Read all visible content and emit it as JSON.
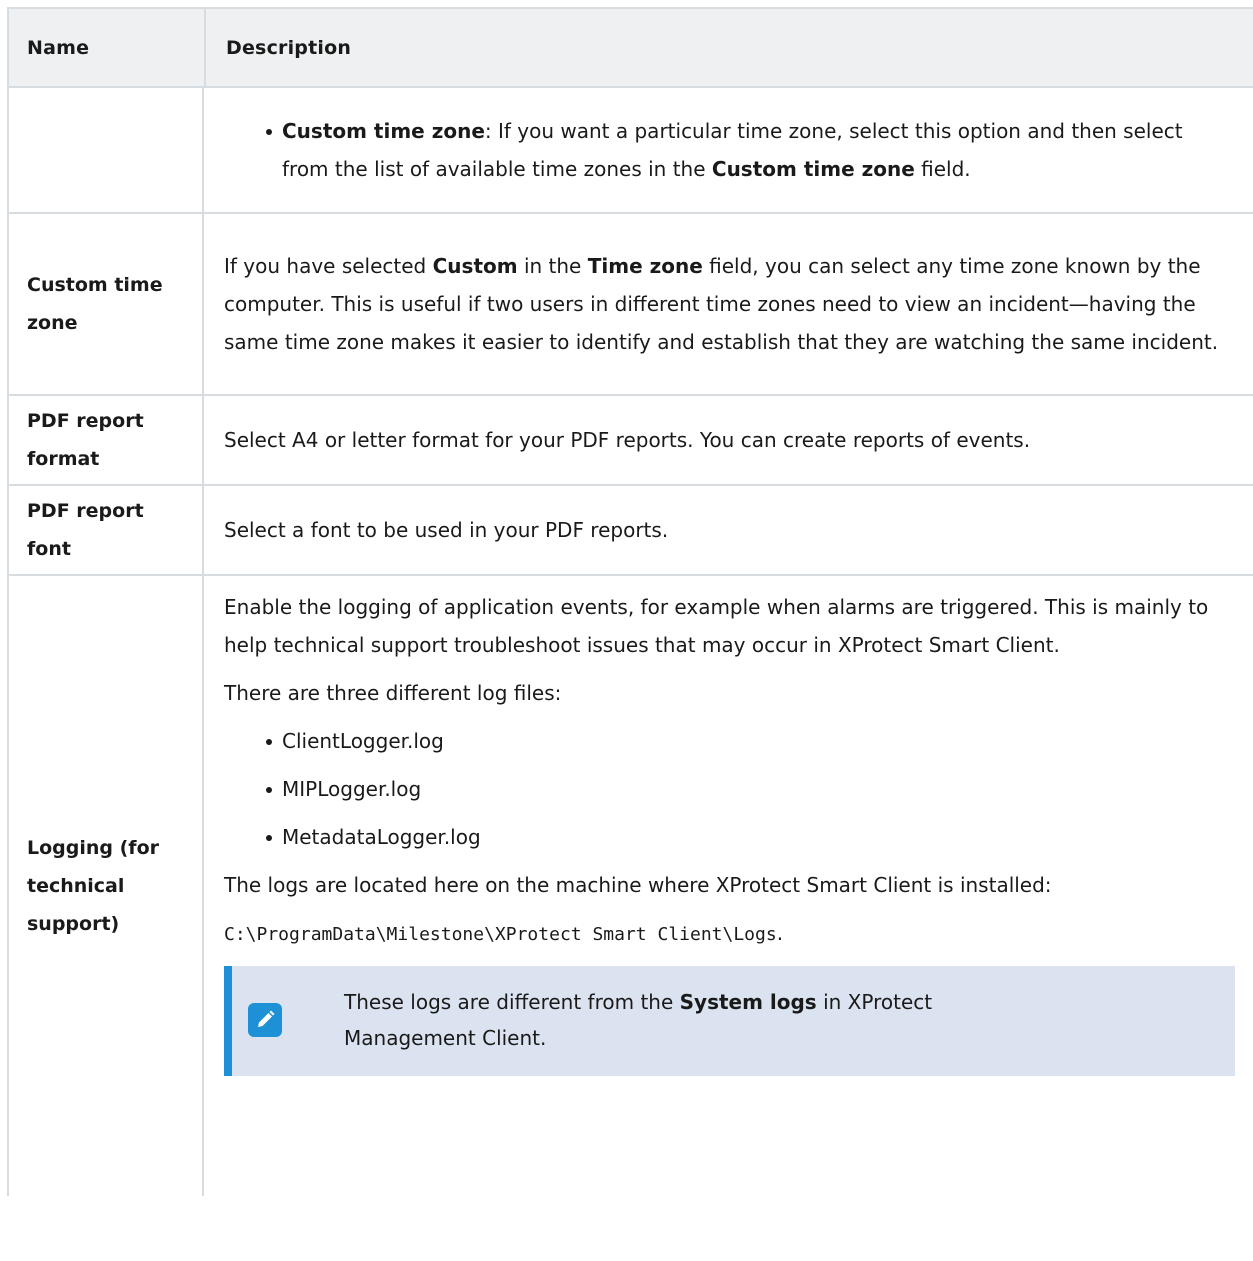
{
  "header": {
    "name": "Name",
    "description": "Description"
  },
  "rows": {
    "time_zone_cont": {
      "bullet_bold": "Custom time zone",
      "bullet_text1": ": If you want a particular time zone, select this option and then select from the list of available time zones in the ",
      "bullet_bold2": "Custom time zone",
      "bullet_text2": " field."
    },
    "custom_time_zone": {
      "name": "Custom time zone",
      "t1": "If you have selected ",
      "b1": "Custom",
      "t2": " in the ",
      "b2": "Time zone",
      "t3": " field, you can select any time zone known by the computer. This is useful if two users in different time zones need to view an incident—having the same time zone makes it easier to identify and establish that they are watching the same incident."
    },
    "pdf_format": {
      "name": "PDF report format",
      "desc": "Select A4 or letter format for your PDF reports. You can create reports of events."
    },
    "pdf_font": {
      "name": "PDF report font",
      "desc": "Select a font to be used in your PDF reports."
    },
    "logging": {
      "name": "Logging (for technical support)",
      "p1": "Enable the logging of application events, for example when alarms are triggered. This is mainly to help technical support troubleshoot issues that may occur in XProtect Smart Client.",
      "p2": "There are three different log files:",
      "files": [
        "ClientLogger.log",
        "MIPLogger.log",
        "MetadataLogger.log"
      ],
      "p3": "The logs are located here on the machine where XProtect Smart Client is installed:",
      "path": "C:\\ProgramData\\Milestone\\XProtect Smart Client\\Logs",
      "path_end": ".",
      "note_t1": "These logs are different from the ",
      "note_b": "System logs",
      "note_t2": " in XProtect Management Client.",
      "note_icon": "pencil-icon"
    }
  }
}
